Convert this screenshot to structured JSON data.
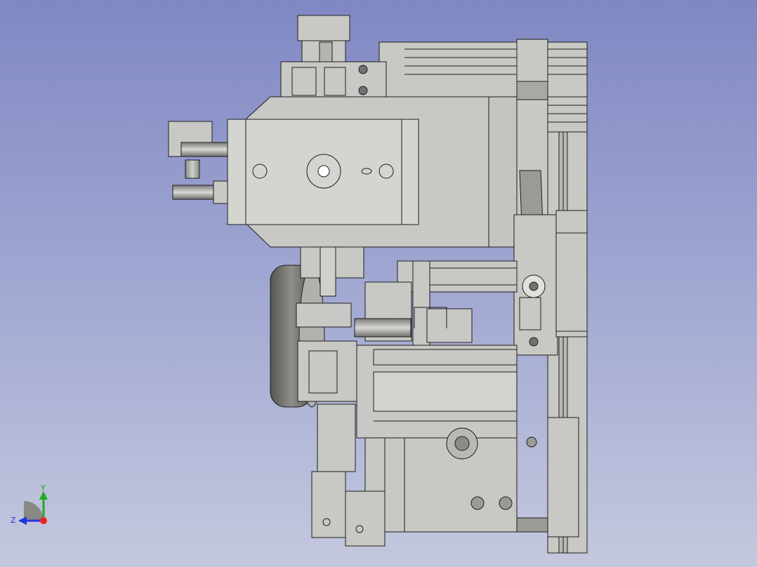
{
  "viewport": {
    "background_top": "#8088c4",
    "background_bottom": "#c4c8de"
  },
  "model": {
    "part_fill": "#c8c8c4",
    "part_fill_light": "#d6d6d2",
    "part_fill_dark": "#9a9a96",
    "edge_color": "#1e1e1e"
  },
  "axis_indicator": {
    "y_label": "Y",
    "z_label": "Z",
    "y_color": "#22aa22",
    "z_color": "#2233dd",
    "x_color": "#ee2222"
  }
}
